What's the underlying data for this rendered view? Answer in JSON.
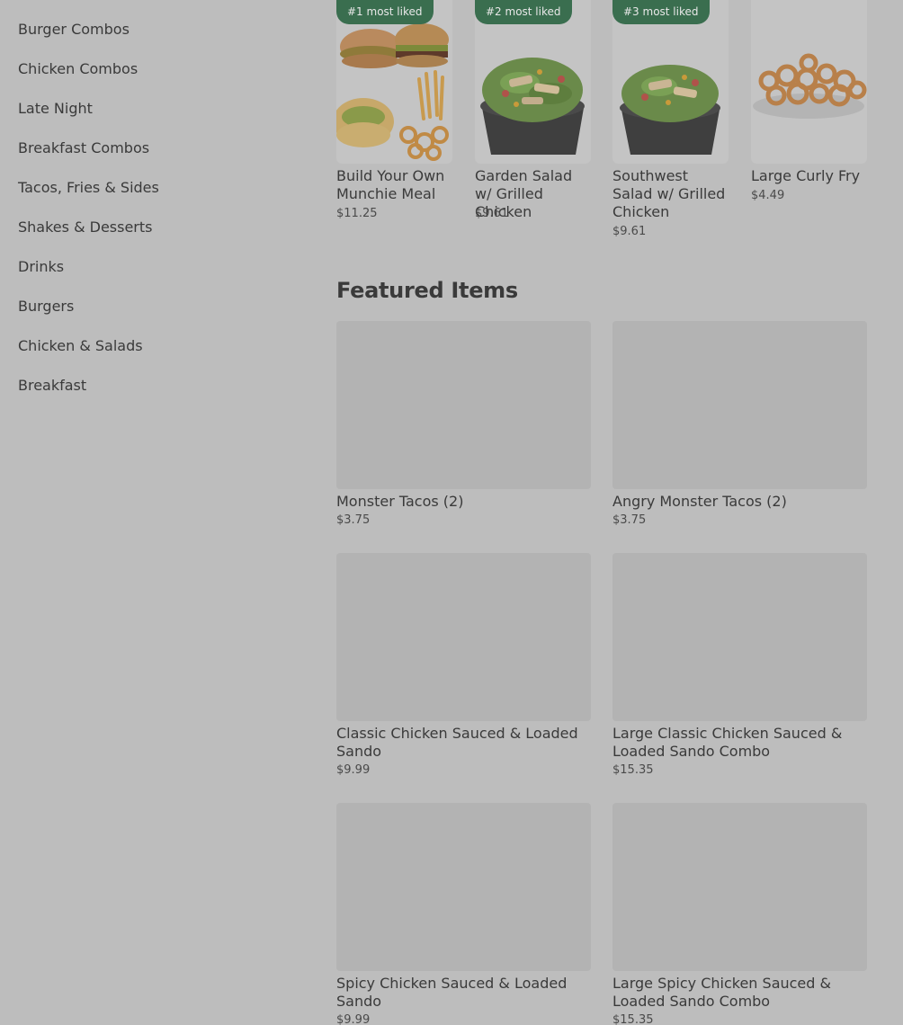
{
  "sidebar": {
    "items": [
      {
        "label": "Burger Combos"
      },
      {
        "label": "Chicken Combos"
      },
      {
        "label": "Late Night"
      },
      {
        "label": "Breakfast Combos"
      },
      {
        "label": "Tacos, Fries & Sides"
      },
      {
        "label": "Shakes & Desserts"
      },
      {
        "label": "Drinks"
      },
      {
        "label": "Burgers"
      },
      {
        "label": "Chicken & Salads"
      },
      {
        "label": "Breakfast"
      }
    ]
  },
  "most_liked": {
    "items": [
      {
        "badge": "#1 most liked",
        "name": "Build Your Own Munchie Meal",
        "price": "$11.25"
      },
      {
        "badge": "#2 most liked",
        "name": "Garden Salad w/ Grilled Chicken",
        "price": "$9.61"
      },
      {
        "badge": "#3 most liked",
        "name": "Southwest Salad w/ Grilled Chicken",
        "price": "$9.61"
      },
      {
        "badge": "",
        "name": "Large Curly Fry",
        "price": "$4.49"
      }
    ]
  },
  "featured": {
    "title": "Featured Items",
    "items": [
      {
        "name": "Monster Tacos (2)",
        "price": "$3.75"
      },
      {
        "name": "Angry Monster Tacos (2)",
        "price": "$3.75"
      },
      {
        "name": "Classic Chicken Sauced & Loaded Sando",
        "price": "$9.99"
      },
      {
        "name": "Large Classic Chicken Sauced & Loaded Sando Combo",
        "price": "$15.35"
      },
      {
        "name": "Spicy Chicken Sauced & Loaded Sando",
        "price": "$9.99"
      },
      {
        "name": "Large Spicy Chicken Sauced & Loaded Sando Combo",
        "price": "$15.35"
      }
    ]
  }
}
